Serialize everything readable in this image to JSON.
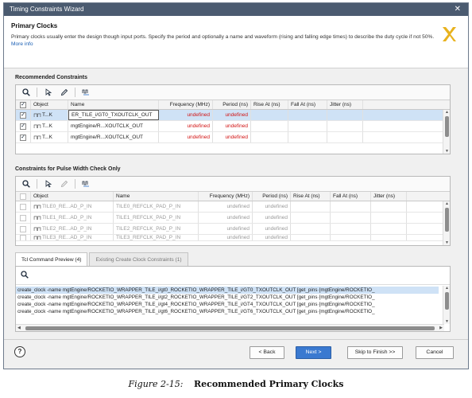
{
  "window": {
    "title": "Timing Constraints Wizard",
    "close_glyph": "✕"
  },
  "header": {
    "title": "Primary Clocks",
    "description": "Primary clocks usually enter the design though input ports. Specify the period and optionally a name and waveform (rising and falling edge times) to describe the duty cycle if not 50%.",
    "more_info": "More info"
  },
  "recommended": {
    "title": "Recommended Constraints",
    "columns": [
      "",
      "Object",
      "Name",
      "Frequency (MHz)",
      "Period (ns)",
      "Rise At (ns)",
      "Fall At (ns)",
      "Jitter (ns)"
    ],
    "rows": [
      {
        "checked": "✓",
        "object": "T...K",
        "name": "ER_TILE_i/GT0_TXOUTCLK_OUT",
        "frequency": "undefined",
        "period": "undefined",
        "rise": "",
        "fall": "",
        "jitter": ""
      },
      {
        "checked": "✓",
        "object": "T...K",
        "name": "mgtEngine/R...XOUTCLK_OUT",
        "frequency": "undefined",
        "period": "undefined",
        "rise": "",
        "fall": "",
        "jitter": ""
      },
      {
        "checked": "✓",
        "object": "T...K",
        "name": "mgtEngine/R...XOUTCLK_OUT",
        "frequency": "undefined",
        "period": "undefined",
        "rise": "",
        "fall": "",
        "jitter": ""
      }
    ]
  },
  "pulse_width": {
    "title": "Constraints for Pulse Width Check Only",
    "columns": [
      "",
      "Object",
      "Name",
      "Frequency (MHz)",
      "Period (ns)",
      "Rise At (ns)",
      "Fall At (ns)",
      "Jitter (ns)"
    ],
    "rows": [
      {
        "object": "TILE0_RE...AD_P_IN",
        "name": "TILE0_REFCLK_PAD_P_IN",
        "frequency": "undefined",
        "period": "undefined"
      },
      {
        "object": "TILE1_RE...AD_P_IN",
        "name": "TILE1_REFCLK_PAD_P_IN",
        "frequency": "undefined",
        "period": "undefined"
      },
      {
        "object": "TILE2_RE...AD_P_IN",
        "name": "TILE2_REFCLK_PAD_P_IN",
        "frequency": "undefined",
        "period": "undefined"
      },
      {
        "object": "TILE3_RE...AD_P_IN",
        "name": "TILE3_REFCLK_PAD_P_IN",
        "frequency": "undefined",
        "period": "undefined"
      }
    ]
  },
  "tabs": [
    {
      "label": "Tcl Command Preview (4)",
      "active": true
    },
    {
      "label": "Existing Create Clock Constraints (1)",
      "active": false
    }
  ],
  "tcl_lines": [
    "create_clock -name mgtEngine/ROCKETIO_WRAPPER_TILE_i/gt0_ROCKETIO_WRAPPER_TILE_i/GT0_TXOUTCLK_OUT [get_pins {mgtEngine/ROCKETIO_",
    "create_clock -name mgtEngine/ROCKETIO_WRAPPER_TILE_i/gt2_ROCKETIO_WRAPPER_TILE_i/GT2_TXOUTCLK_OUT [get_pins {mgtEngine/ROCKETIO_",
    "create_clock -name mgtEngine/ROCKETIO_WRAPPER_TILE_i/gt4_ROCKETIO_WRAPPER_TILE_i/GT4_TXOUTCLK_OUT [get_pins {mgtEngine/ROCKETIO_",
    "create_clock -name mgtEngine/ROCKETIO_WRAPPER_TILE_i/gt6_ROCKETIO_WRAPPER_TILE_i/GT6_TXOUTCLK_OUT [get_pins {mgtEngine/ROCKETIO_"
  ],
  "footer": {
    "help": "?",
    "back": "< Back",
    "next": "Next >",
    "skip": "Skip to Finish >>",
    "cancel": "Cancel"
  },
  "caption": {
    "figure": "Figure 2-15:",
    "title": "Recommended Primary Clocks"
  },
  "colors": {
    "titlebar": "#4b5b70",
    "primary_button": "#3a79d0",
    "undefined_text": "#d21414",
    "selection": "#cfe2f6",
    "logo": "#e8b21e"
  }
}
